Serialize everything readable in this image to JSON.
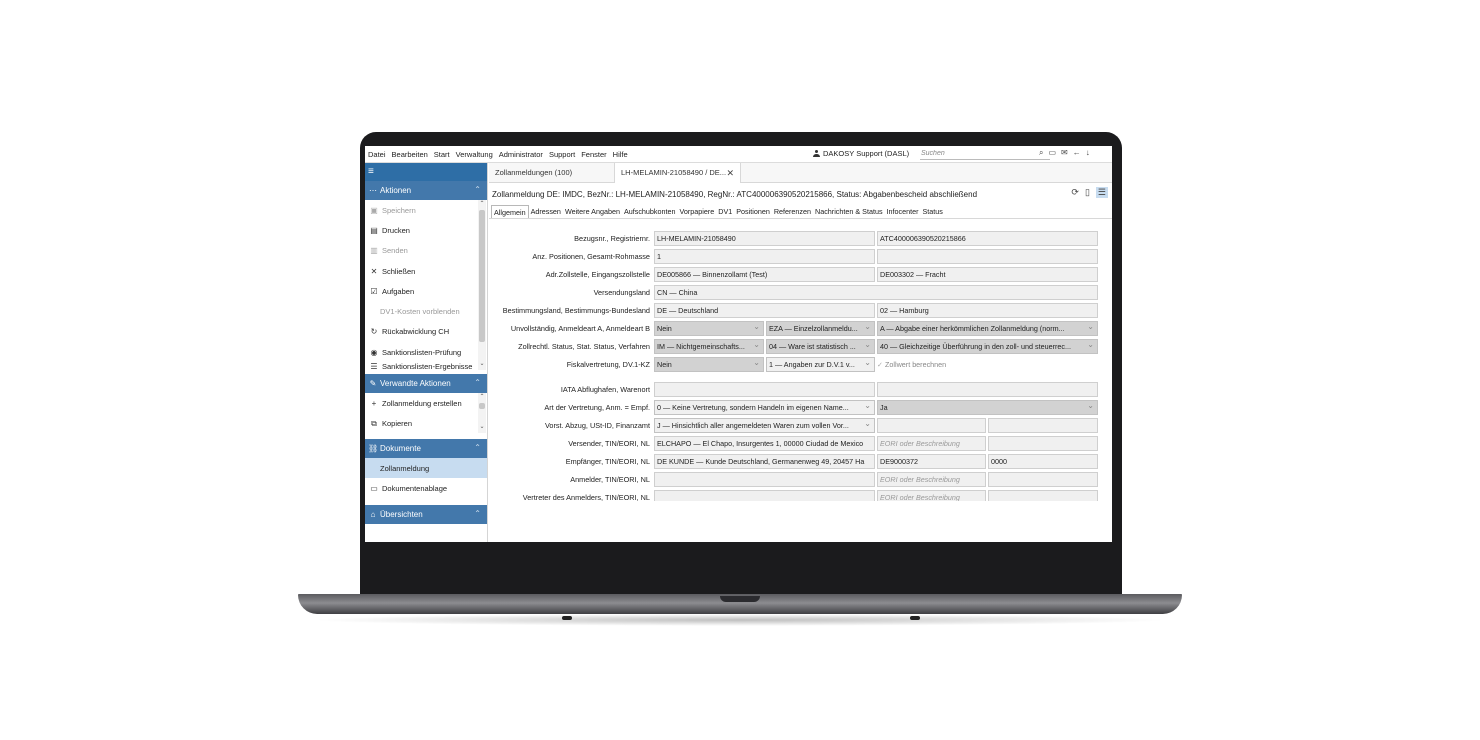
{
  "menu": [
    "Datei",
    "Bearbeiten",
    "Start",
    "Verwaltung",
    "Administrator",
    "Support",
    "Fenster",
    "Hilfe"
  ],
  "user": "DAKOSY Support (DASL)",
  "search": {
    "placeholder": "Suchen"
  },
  "top_icons": [
    "search-icon",
    "message-icon",
    "mail-icon",
    "back-icon",
    "download-icon"
  ],
  "sidebar": {
    "sections": [
      {
        "title": "Aktionen",
        "icon": "dots-icon"
      },
      {
        "title": "Verwandte Aktionen",
        "icon": "edit-icon"
      },
      {
        "title": "Dokumente",
        "icon": "link-icon"
      },
      {
        "title": "Übersichten",
        "icon": "home-icon"
      }
    ],
    "actions": [
      "Speichern",
      "Drucken",
      "Senden",
      "Schließen",
      "Aufgaben",
      "DV1-Kosten vorblenden",
      "Rückabwicklung CH",
      "Sanktionslisten-Prüfung",
      "Sanktionslisten-Ergebnisse"
    ],
    "related": [
      "Zollanmeldung erstellen",
      "Kopieren"
    ],
    "documents": [
      "Zollanmeldung",
      "Dokumentenablage"
    ]
  },
  "tabs": [
    {
      "label": "Zollanmeldungen (100)"
    },
    {
      "label": "LH-MELAMIN-21058490 / DE..."
    }
  ],
  "doc_title": "Zollanmeldung DE: IMDC, BezNr.: LH-MELAMIN-21058490, RegNr.: ATC400006390520215866, Status: Abgabenbescheid abschließend",
  "subtabs": [
    "Allgemein",
    "Adressen",
    "Weitere Angaben",
    "Aufschubkonten",
    "Vorpapiere",
    "DV1",
    "Positionen",
    "Referenzen",
    "Nachrichten & Status",
    "Infocenter",
    "Status"
  ],
  "form": {
    "r1": {
      "label": "Bezugsnr., Registriernr.",
      "a": "LH-MELAMIN-21058490",
      "b": "ATC400006390520215866"
    },
    "r2": {
      "label": "Anz. Positionen, Gesamt-Rohmasse",
      "a": "1",
      "b": ""
    },
    "r3": {
      "label": "Adr.Zollstelle, Eingangszollstelle",
      "a": "DE005866 — Binnenzollamt (Test)",
      "b": "DE003302 — Fracht"
    },
    "r4": {
      "label": "Versendungsland",
      "a": "CN — China"
    },
    "r5": {
      "label": "Bestimmungsland, Bestimmungs-Bundesland",
      "a": "DE — Deutschland",
      "b": "02 — Hamburg"
    },
    "r6": {
      "label": "Unvollständig, Anmeldeart A, Anmeldeart B",
      "a": "Nein",
      "b": "EZA — Einzelzollanmeldu...",
      "c": "A — Abgabe einer herkömmlichen Zollanmeldung (norm..."
    },
    "r7": {
      "label": "Zollrechtl. Status, Stat. Status, Verfahren",
      "a": "IM — Nichtgemeinschafts...",
      "b": "04 — Ware ist statistisch ...",
      "c": "40 — Gleichzeitige Überführung in den zoll- und steuerrec..."
    },
    "r8": {
      "label": "Fiskalvertretung, DV.1-KZ",
      "a": "Nein",
      "b": "1 — Angaben zur D.V.1 v...",
      "check": "Zollwert berechnen"
    },
    "r9": {
      "label": "IATA Abflughafen, Warenort",
      "a": "",
      "b": ""
    },
    "r10": {
      "label": "Art der Vertretung, Anm. = Empf.",
      "a": "0 — Keine Vertretung, sondern Handeln im eigenen Name...",
      "b": "Ja"
    },
    "r11": {
      "label": "Vorst. Abzug, USt-ID, Finanzamt",
      "a": "J — Hinsichtlich aller angemeldeten Waren zum vollen Vor...",
      "b": "",
      "c": ""
    },
    "r12": {
      "label": "Versender, TIN/EORI, NL",
      "a": "ELCHAPO — El Chapo, Insurgentes 1, 00000 Ciudad de Mexico",
      "b": "EORI oder Beschreibung",
      "c": ""
    },
    "r13": {
      "label": "Empfänger, TIN/EORI, NL",
      "a": "DE KUNDE — Kunde Deutschland, Germanenweg 49, 20457 Ha",
      "b": "DE9000372",
      "c": "0000"
    },
    "r14": {
      "label": "Anmelder, TIN/EORI, NL",
      "a": "",
      "b": "EORI oder Beschreibung",
      "c": ""
    },
    "r15": {
      "label": "Vertreter des Anmelders, TIN/EORI, NL",
      "a": "",
      "b": "EORI oder Beschreibung",
      "c": ""
    }
  }
}
